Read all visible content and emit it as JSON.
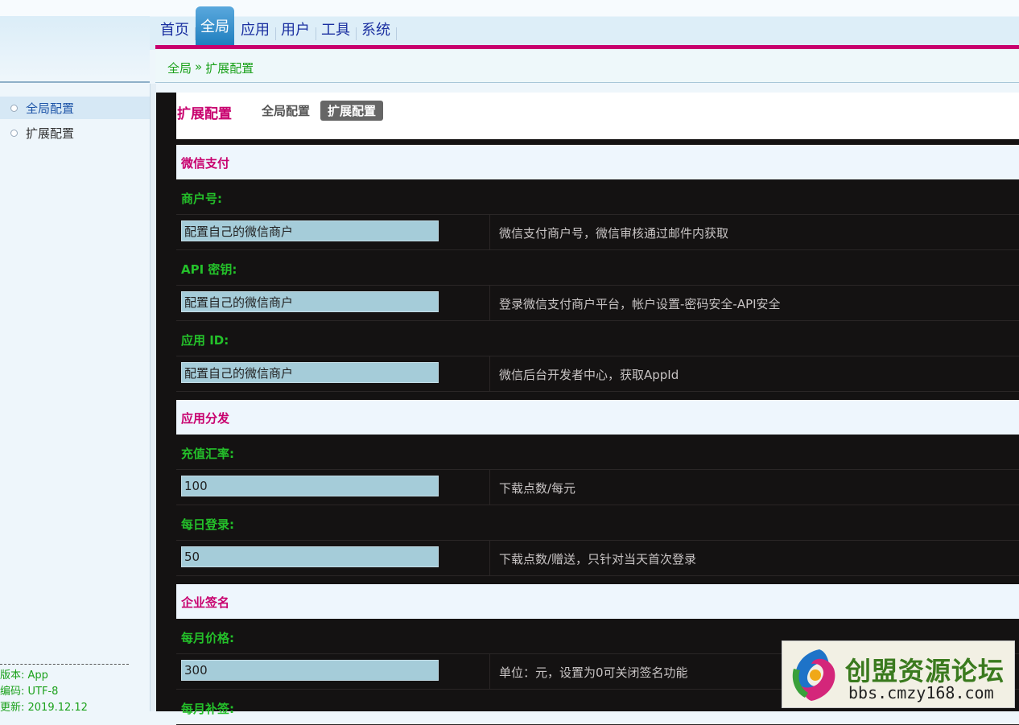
{
  "nav": {
    "items": [
      {
        "label": "首页",
        "active": false
      },
      {
        "label": "全局",
        "active": true
      },
      {
        "label": "应用",
        "active": false
      },
      {
        "label": "用户",
        "active": false
      },
      {
        "label": "工具",
        "active": false
      },
      {
        "label": "系统",
        "active": false
      }
    ]
  },
  "breadcrumb": {
    "root": "全局",
    "separator": "»",
    "current": "扩展配置"
  },
  "sidebar": {
    "items": [
      {
        "label": "全局配置",
        "active": true
      },
      {
        "label": "扩展配置",
        "active": false
      }
    ],
    "footer": {
      "version": "版本: App",
      "encoding": "编码: UTF-8",
      "updated": "更新: 2019.12.12"
    }
  },
  "page": {
    "title": "扩展配置",
    "tabs": [
      {
        "label": "全局配置",
        "current": false
      },
      {
        "label": "扩展配置",
        "current": true
      }
    ]
  },
  "sections": [
    {
      "title": "微信支付",
      "fields": [
        {
          "label": "商户号:",
          "value": "配置自己的微信商户",
          "desc": "微信支付商户号，微信审核通过邮件内获取"
        },
        {
          "label": "API 密钥:",
          "value": "配置自己的微信商户",
          "desc": "登录微信支付商户平台，帐户设置-密码安全-API安全"
        },
        {
          "label": "应用 ID:",
          "value": "配置自己的微信商户",
          "desc": "微信后台开发者中心，获取AppId"
        }
      ]
    },
    {
      "title": "应用分发",
      "fields": [
        {
          "label": "充值汇率:",
          "value": "100",
          "desc": "下载点数/每元"
        },
        {
          "label": "每日登录:",
          "value": "50",
          "desc": "下载点数/赠送，只针对当天首次登录"
        }
      ]
    },
    {
      "title": "企业签名",
      "fields": [
        {
          "label": "每月价格:",
          "value": "300",
          "desc": "单位：元，设置为0可关闭签名功能"
        },
        {
          "label": "每月补签:",
          "value": "",
          "desc": ""
        }
      ]
    }
  ],
  "watermark": {
    "title": "创盟资源论坛",
    "url": "bbs.cmzy168.com"
  },
  "colors": {
    "accent": "#c8006e",
    "label_green": "#24c02a",
    "nav_blue": "#1a2fa0",
    "input_bg": "#a5ccd9"
  }
}
